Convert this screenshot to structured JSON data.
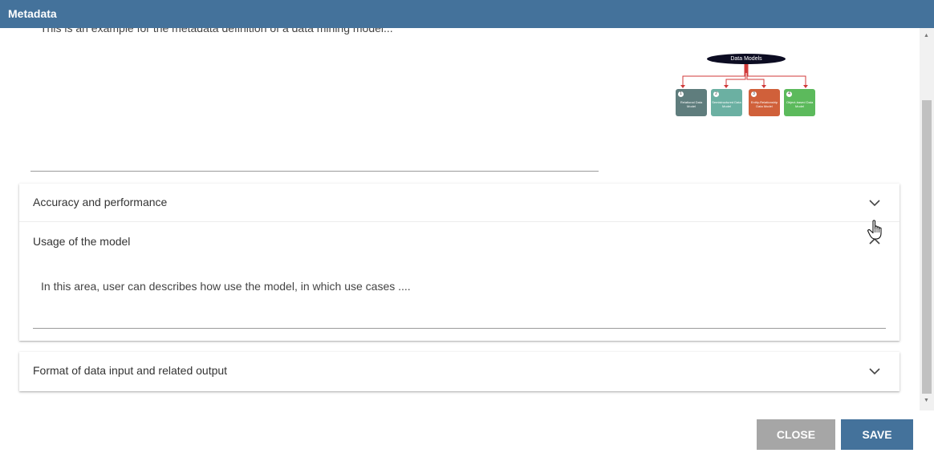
{
  "window": {
    "title": "Metadata"
  },
  "description": {
    "text": "This is an example for the metadata definition of a data mining model..."
  },
  "diagram": {
    "title": "Data Models",
    "boxes": [
      {
        "num": "1",
        "label": "Relational Data Model",
        "color": "#5f7d7d"
      },
      {
        "num": "2",
        "label": "Semistructured Data Model",
        "color": "#6bb0a2"
      },
      {
        "num": "3",
        "label": "Entity-Relationship Data Model",
        "color": "#d0603a"
      },
      {
        "num": "4",
        "label": "Object-based Data Model",
        "color": "#5cba5c"
      }
    ]
  },
  "sections": [
    {
      "title": "Accuracy and performance",
      "expanded": false
    },
    {
      "title": "Usage of the model",
      "expanded": true,
      "body": "In this area, user can describes how use the model, in which use cases ...."
    },
    {
      "title": "Format of data input and related output",
      "expanded": false
    }
  ],
  "buttons": {
    "close": "CLOSE",
    "save": "SAVE"
  },
  "colors": {
    "header": "#44729b",
    "save": "#44729b",
    "close": "#a6a6a6",
    "arrow": "#d03a3a"
  }
}
